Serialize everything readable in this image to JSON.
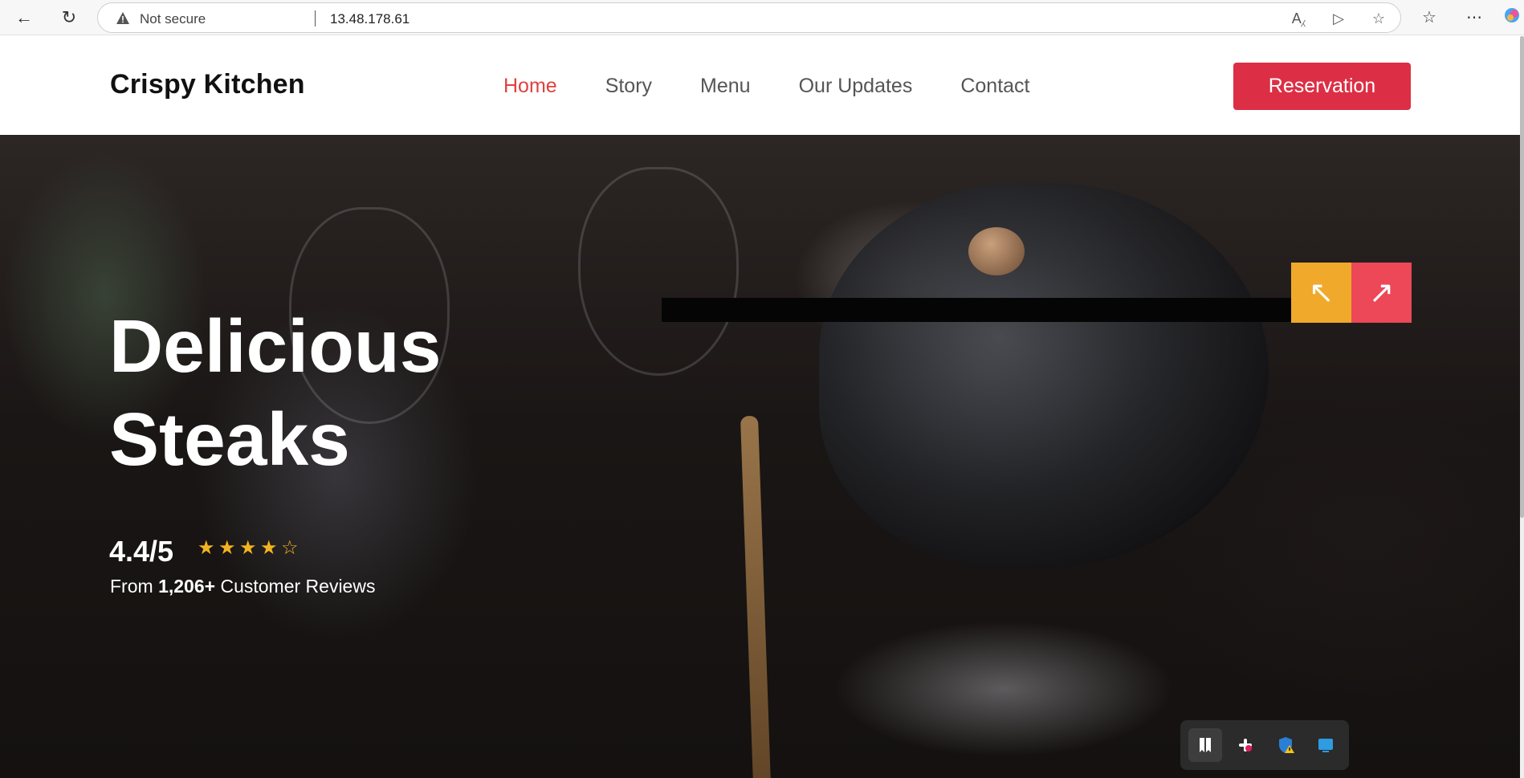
{
  "browser": {
    "security_label": "Not secure",
    "url": "13.48.178.61",
    "icons": [
      "back-icon",
      "refresh-icon",
      "warning-icon",
      "read-aloud-icon",
      "immersive-reader-icon",
      "favorite-star-icon",
      "favorites-icon",
      "more-icon",
      "copilot-icon"
    ]
  },
  "site": {
    "brand": "Crispy Kitchen",
    "nav": [
      {
        "label": "Home",
        "active": true
      },
      {
        "label": "Story",
        "active": false
      },
      {
        "label": "Menu",
        "active": false
      },
      {
        "label": "Our Updates",
        "active": false
      },
      {
        "label": "Contact",
        "active": false
      }
    ],
    "reservation_label": "Reservation"
  },
  "hero": {
    "title_line1": "Delicious",
    "title_line2": "Steaks",
    "rating": "4.4/5",
    "stars_filled": 4,
    "stars_total": 5,
    "reviews_prefix": "From",
    "reviews_count": "1,206+",
    "reviews_suffix": "Customer Reviews",
    "prev_arrow": "↖",
    "next_arrow": "↗"
  },
  "colors": {
    "accent_red": "#dc2f45",
    "nav_active": "#e0413f",
    "star_gold": "#f3b320",
    "prev_button": "#f0a92a",
    "next_button": "#ec4857"
  },
  "dock": {
    "icons": [
      "bookmark-app-icon",
      "slack-icon",
      "security-warning-icon",
      "window-app-icon"
    ]
  }
}
